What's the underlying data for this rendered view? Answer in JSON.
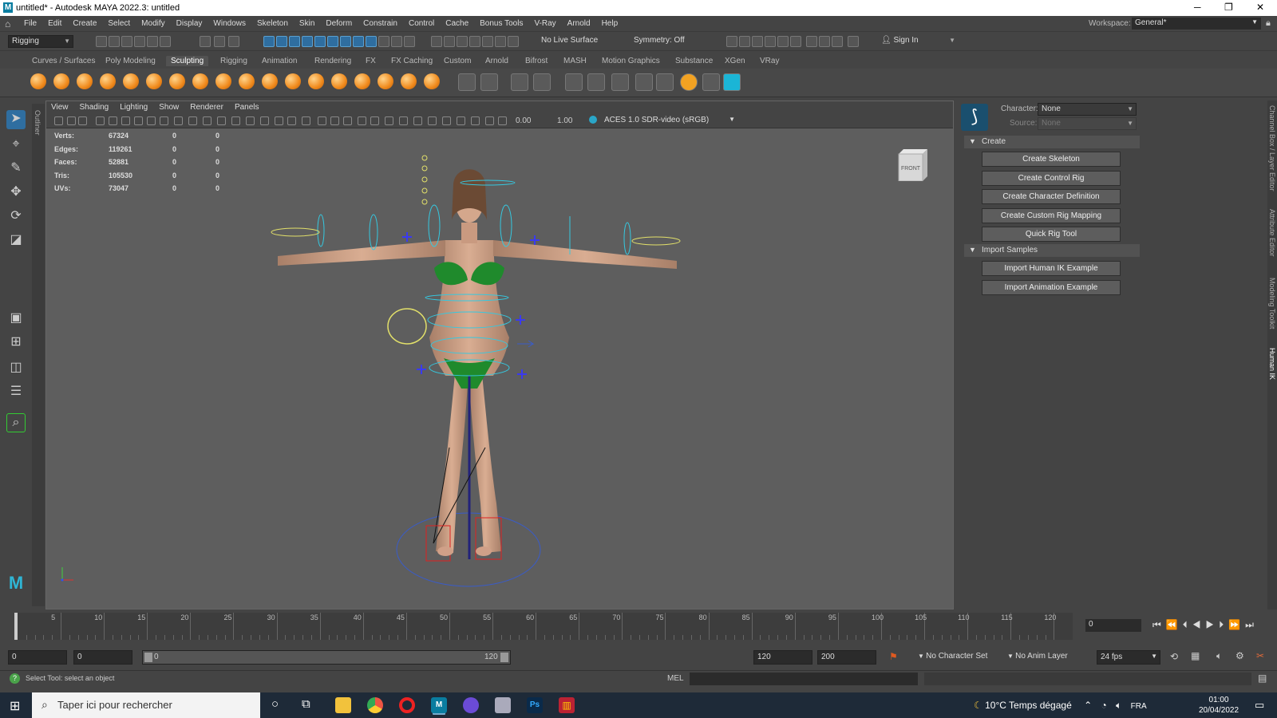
{
  "window": {
    "title": "untitled* - Autodesk MAYA 2022.3: untitled",
    "logo_letter": "M"
  },
  "menu": [
    "File",
    "Edit",
    "Create",
    "Select",
    "Modify",
    "Display",
    "Windows",
    "Skeleton",
    "Skin",
    "Deform",
    "Constrain",
    "Control",
    "Cache",
    "Bonus Tools",
    "V-Ray",
    "Arnold",
    "Help"
  ],
  "workspace": {
    "label": "Workspace:",
    "value": "General*"
  },
  "statusline": {
    "menuset": "Rigging",
    "live_surface": "No Live Surface",
    "symmetry": "Symmetry: Off",
    "sign_in": "Sign In"
  },
  "shelf_tabs": [
    "Curves / Surfaces",
    "Poly Modeling",
    "Sculpting",
    "Rigging",
    "Animation",
    "Rendering",
    "FX",
    "FX Caching",
    "Custom",
    "Arnold",
    "Bifrost",
    "MASH",
    "Motion Graphics",
    "Substance",
    "XGen",
    "VRay"
  ],
  "active_shelf_tab": "Sculpting",
  "outliner_label": "Outliner",
  "viewport": {
    "menu": [
      "View",
      "Shading",
      "Lighting",
      "Show",
      "Renderer",
      "Panels"
    ],
    "exposure": "0.00",
    "gamma": "1.00",
    "colorspace": "ACES 1.0 SDR-video (sRGB)",
    "viewcube_label": "FRONT",
    "hud": [
      {
        "label": "Verts:",
        "v1": "67324",
        "v2": "0",
        "v3": "0"
      },
      {
        "label": "Edges:",
        "v1": "119261",
        "v2": "0",
        "v3": "0"
      },
      {
        "label": "Faces:",
        "v1": "52881",
        "v2": "0",
        "v3": "0"
      },
      {
        "label": "Tris:",
        "v1": "105530",
        "v2": "0",
        "v3": "0"
      },
      {
        "label": "UVs:",
        "v1": "73047",
        "v2": "0",
        "v3": "0"
      }
    ]
  },
  "humanik": {
    "character_label": "Character:",
    "character_value": "None",
    "source_label": "Source:",
    "source_value": "None",
    "create_section": "Create",
    "create_buttons": [
      "Create Skeleton",
      "Create Control Rig",
      "Create Character Definition",
      "Create Custom Rig Mapping",
      "Quick Rig Tool"
    ],
    "import_section": "Import Samples",
    "import_buttons": [
      "Import Human IK Example",
      "Import Animation Example"
    ]
  },
  "side_tabs": [
    "Channel Box / Layer Editor",
    "Attribute Editor",
    "Modeling Toolkit",
    "Human IK"
  ],
  "timeline": {
    "ticks": [
      "5",
      "10",
      "15",
      "20",
      "25",
      "30",
      "35",
      "40",
      "45",
      "50",
      "55",
      "60",
      "65",
      "70",
      "75",
      "80",
      "85",
      "90",
      "95",
      "100",
      "105",
      "110",
      "115",
      "120"
    ],
    "current_frame": "0"
  },
  "range": {
    "start": "0",
    "anim_start": "0",
    "slider_start": "0",
    "slider_end": "120",
    "end": "120",
    "anim_end": "200",
    "character_set": "No Character Set",
    "anim_layer": "No Anim Layer",
    "fps": "24 fps"
  },
  "helpline": {
    "text": "Select Tool: select an object",
    "mel": "MEL"
  },
  "taskbar": {
    "search": "Taper ici pour rechercher",
    "weather": "10°C  Temps dégagé",
    "lang": "FRA",
    "time": "01:00",
    "date": "20/04/2022"
  },
  "colors": {
    "accent": "#2f6ea0",
    "maya_teal": "#0a7da0",
    "viewport_bg": "#5e5e5e"
  }
}
